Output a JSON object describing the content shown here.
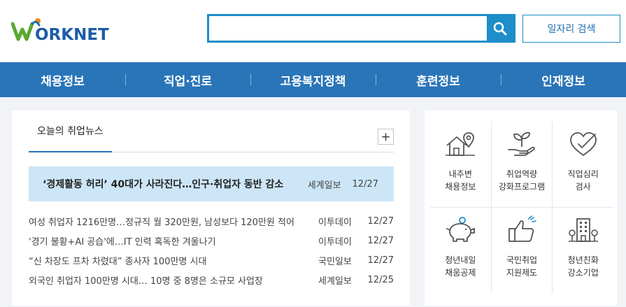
{
  "header": {
    "logo_text": "ORKNET",
    "search_placeholder": "",
    "job_search_label": "일자리 검색"
  },
  "nav": {
    "items": [
      "채용정보",
      "직업·진로",
      "고용복지정책",
      "훈련정보",
      "인재정보"
    ]
  },
  "news": {
    "tab_label": "오늘의 취업뉴스",
    "more_label": "+",
    "featured": {
      "title": "‘경제활동 허리’ 40대가 사라진다…인구·취업자 동반 감소",
      "source": "세계일보",
      "date": "12/27"
    },
    "items": [
      {
        "title": "여성 취업자 1216만명…정규직 월 320만원, 남성보다 120만원 적어",
        "source": "이투데이",
        "date": "12/27"
      },
      {
        "title": "'경기 불황+AI 공습'에…IT 인력 혹독한 겨울나기",
        "source": "이투데이",
        "date": "12/27"
      },
      {
        "title": "“신 차장도 프차 차렸대” 종사자 100만명 시대",
        "source": "국민일보",
        "date": "12/27"
      },
      {
        "title": "외국인 취업자 100만명 시대… 10명 중 8명은 소규모 사업장",
        "source": "세계일보",
        "date": "12/25"
      }
    ]
  },
  "services": {
    "row1": [
      {
        "label": "내주변\n채용정보",
        "icon": "house-location-icon"
      },
      {
        "label": "취업역량\n강화프로그램",
        "icon": "hand-sprout-icon"
      },
      {
        "label": "직업심리\n검사",
        "icon": "heart-pen-icon"
      }
    ],
    "row2": [
      {
        "label": "청년내일\n채움공제",
        "icon": "piggy-bank-icon"
      },
      {
        "label": "국민취업\n지원제도",
        "icon": "thumbs-up-icon"
      },
      {
        "label": "청년친화\n강소기업",
        "icon": "building-icon"
      }
    ]
  },
  "colors": {
    "brand_blue": "#2a75b8",
    "search_blue": "#1d8ec9",
    "featured_bg": "#cde6f7",
    "logo_green": "#5aa832",
    "logo_orange": "#f08a1c"
  }
}
